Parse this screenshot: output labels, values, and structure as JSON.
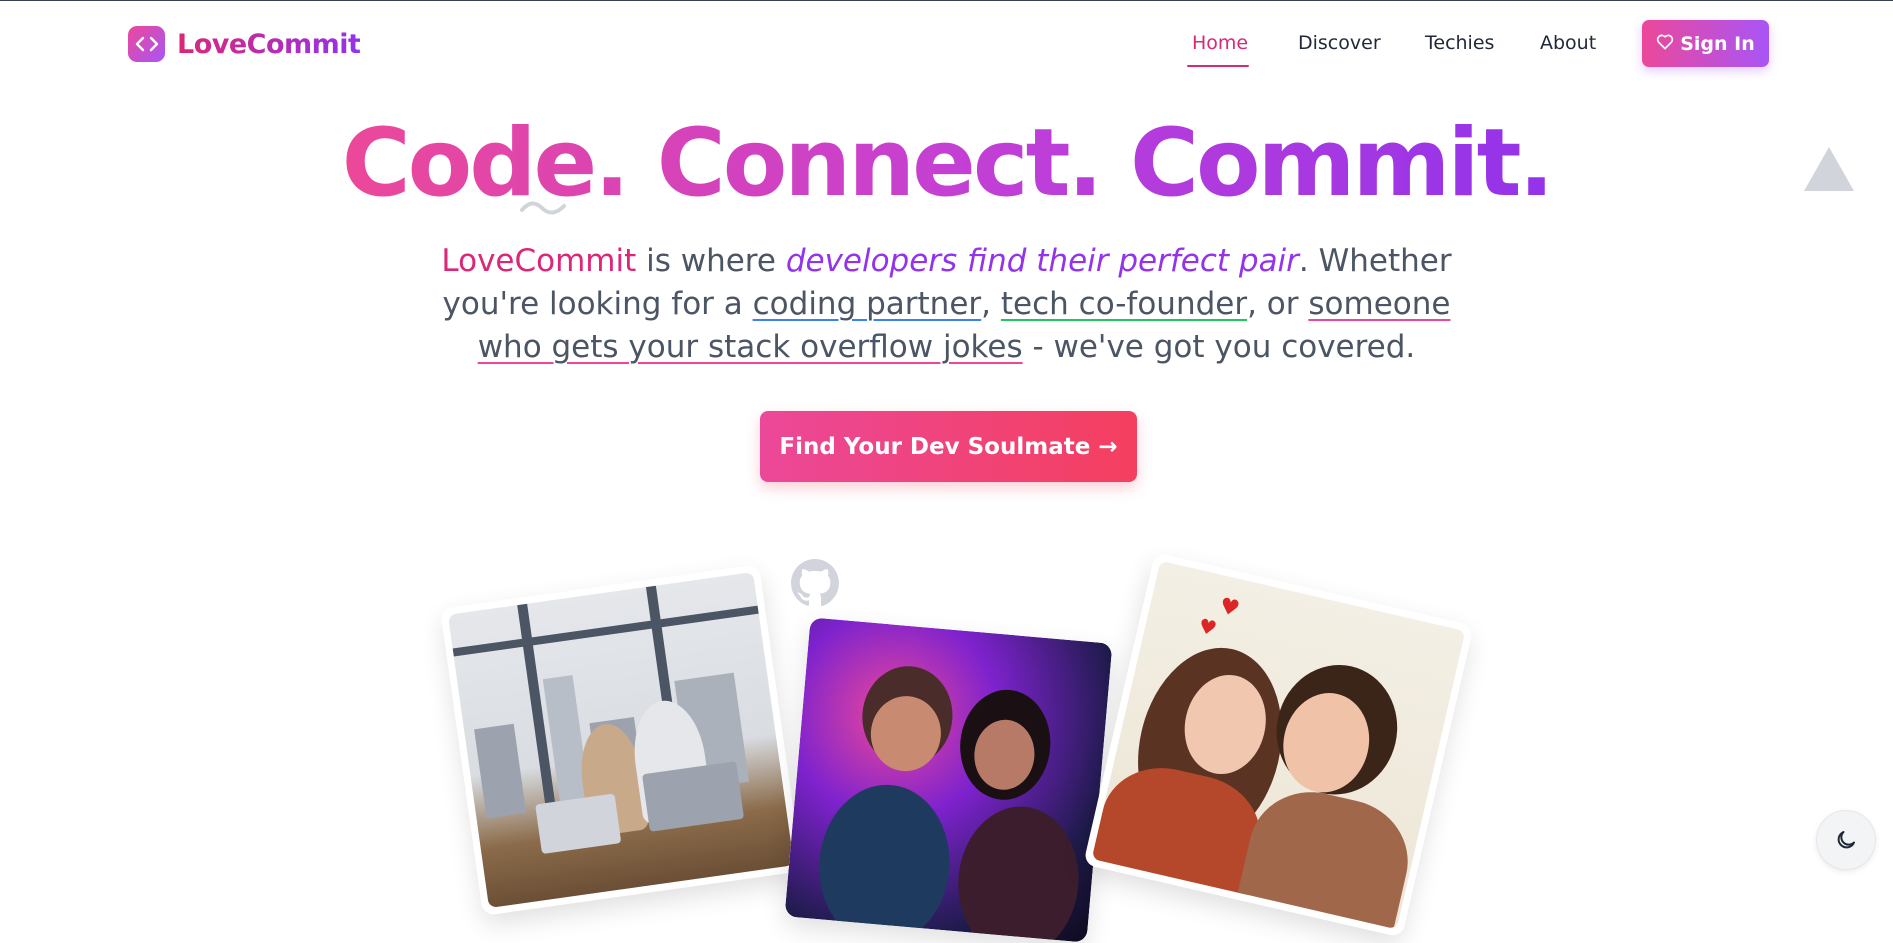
{
  "brand": {
    "name": "LoveCommit",
    "logo_icon": "code-brackets-icon",
    "gradient_start": "#ec4899",
    "gradient_end": "#a855f7"
  },
  "nav": {
    "items": [
      {
        "label": "Home",
        "active": true
      },
      {
        "label": "Discover",
        "active": false
      },
      {
        "label": "Techies",
        "active": false
      },
      {
        "label": "About",
        "active": false
      }
    ],
    "signin_label": "Sign In",
    "signin_icon": "heart-outline-icon",
    "active_color": "#db2777"
  },
  "hero": {
    "title": "Code. Connect. Commit.",
    "desc": {
      "brand": "LoveCommit",
      "t1": " is where ",
      "accent": "developers find their perfect pair",
      "t2": ". Whether you're looking for a ",
      "u1": "coding partner",
      "t3": ", ",
      "u2": "tech co-founder",
      "t4": ", or ",
      "u3": "someone who gets your stack overflow jokes",
      "t5": " - we've got you covered."
    },
    "cta_label": "Find Your Dev Soulmate →"
  },
  "decorations": {
    "github_icon": "github-icon",
    "triangle_color": "#d1d5db"
  },
  "theme_toggle": {
    "icon": "moon-icon"
  }
}
